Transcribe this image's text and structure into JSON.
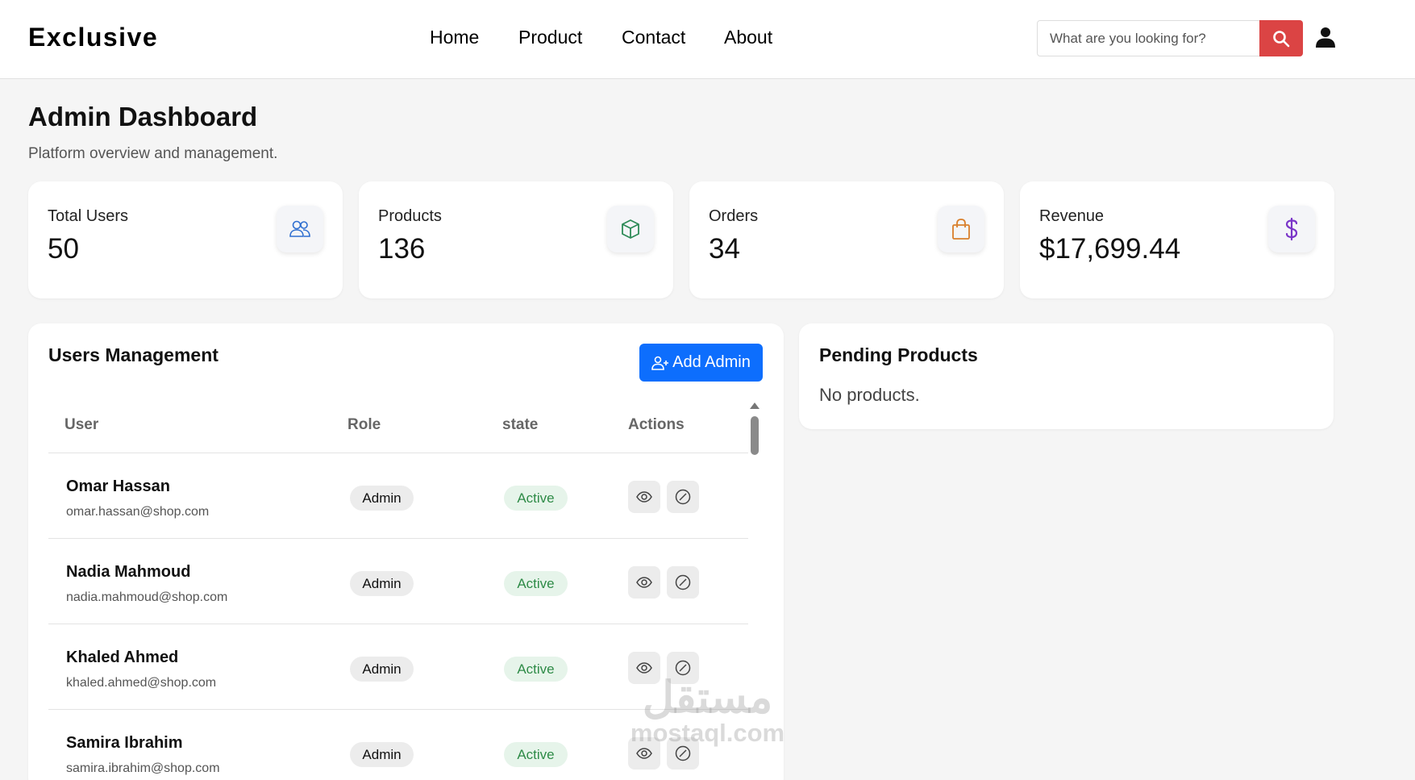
{
  "header": {
    "logo": "Exclusive",
    "nav": [
      {
        "label": "Home"
      },
      {
        "label": "Product"
      },
      {
        "label": "Contact"
      },
      {
        "label": "About"
      }
    ],
    "search": {
      "placeholder": "What are you looking for?",
      "value": ""
    },
    "accent_color": "#DB4444"
  },
  "page": {
    "title": "Admin Dashboard",
    "subtitle": "Platform overview and management."
  },
  "stats": [
    {
      "label": "Total Users",
      "value": "50",
      "icon": "users-icon",
      "icon_color": "#2F6FD0"
    },
    {
      "label": "Products",
      "value": "136",
      "icon": "box-icon",
      "icon_color": "#2E8B57"
    },
    {
      "label": "Orders",
      "value": "34",
      "icon": "shopping-bag-icon",
      "icon_color": "#D97F2B"
    },
    {
      "label": "Revenue",
      "value": "$17,699.44",
      "icon": "dollar-icon",
      "icon_color": "#7A35C8"
    }
  ],
  "users": {
    "title": "Users Management",
    "add_button": "Add Admin",
    "button_color": "#0D6EFD",
    "columns": [
      "User",
      "Role",
      "state",
      "Actions"
    ],
    "rows": [
      {
        "name": "Omar Hassan",
        "email": "omar.hassan@shop.com",
        "role": "Admin",
        "state": "Active"
      },
      {
        "name": "Nadia Mahmoud",
        "email": "nadia.mahmoud@shop.com",
        "role": "Admin",
        "state": "Active"
      },
      {
        "name": "Khaled Ahmed",
        "email": "khaled.ahmed@shop.com",
        "role": "Admin",
        "state": "Active"
      },
      {
        "name": "Samira Ibrahim",
        "email": "samira.ibrahim@shop.com",
        "role": "Admin",
        "state": "Active"
      }
    ]
  },
  "pending": {
    "title": "Pending Products",
    "empty_text": "No products."
  },
  "watermark": {
    "arabic": "مستقل",
    "latin": "mostaql.com"
  }
}
